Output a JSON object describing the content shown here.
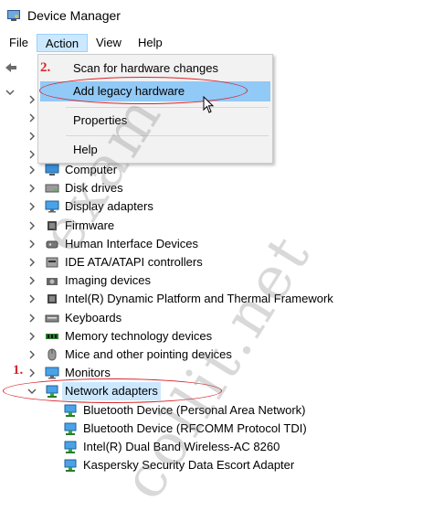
{
  "window": {
    "title": "Device Manager"
  },
  "menu": {
    "file": "File",
    "action": "Action",
    "view": "View",
    "help": "Help"
  },
  "dropdown": {
    "items": [
      {
        "label": "Scan for hardware changes"
      },
      {
        "label": "Add legacy hardware"
      },
      {
        "label": "Properties"
      },
      {
        "label": "Help"
      }
    ]
  },
  "annotations": {
    "step1": "1.",
    "step2": "2."
  },
  "watermark": {
    "text1": "exam",
    "text2": "collit.net"
  },
  "tree": {
    "categories": [
      {
        "label": "Computer",
        "icon": "computer-icon"
      },
      {
        "label": "Disk drives",
        "icon": "disk-drive-icon"
      },
      {
        "label": "Display adapters",
        "icon": "monitor-icon"
      },
      {
        "label": "Firmware",
        "icon": "chip-icon"
      },
      {
        "label": "Human Interface Devices",
        "icon": "hid-icon"
      },
      {
        "label": "IDE ATA/ATAPI controllers",
        "icon": "ide-icon"
      },
      {
        "label": "Imaging devices",
        "icon": "camera-icon"
      },
      {
        "label": "Intel(R) Dynamic Platform and Thermal Framework",
        "icon": "chip-icon"
      },
      {
        "label": "Keyboards",
        "icon": "keyboard-icon"
      },
      {
        "label": "Memory technology devices",
        "icon": "memory-icon"
      },
      {
        "label": "Mice and other pointing devices",
        "icon": "mouse-icon"
      },
      {
        "label": "Monitors",
        "icon": "monitor-icon"
      },
      {
        "label": "Network adapters",
        "icon": "network-icon"
      }
    ],
    "network_children": [
      {
        "label": "Bluetooth Device (Personal Area Network)"
      },
      {
        "label": "Bluetooth Device (RFCOMM Protocol TDI)"
      },
      {
        "label": "Intel(R) Dual Band Wireless-AC 8260"
      },
      {
        "label": "Kaspersky Security Data Escort Adapter"
      }
    ]
  },
  "colors": {
    "menu_active": "#cce8ff",
    "dropdown_hover": "#91c9f7",
    "annotation": "#d9262c"
  }
}
